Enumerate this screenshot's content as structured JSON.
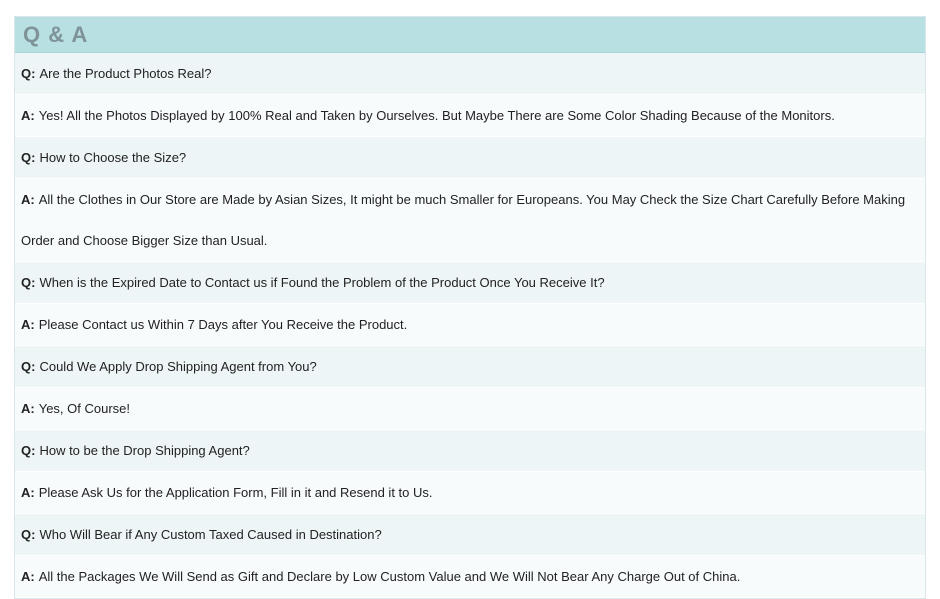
{
  "header": {
    "title": "Q & A"
  },
  "labels": {
    "question": "Q:",
    "answer": "A:"
  },
  "items": [
    {
      "type": "q",
      "text": "Are the Product Photos Real?"
    },
    {
      "type": "a",
      "text": "Yes! All the Photos Displayed by 100% Real and Taken by Ourselves. But Maybe There are Some Color Shading Because of the Monitors."
    },
    {
      "type": "q",
      "text": "How to Choose the Size?"
    },
    {
      "type": "a",
      "text": "All the Clothes in Our Store are Made by Asian Sizes, It might be much Smaller for Europeans. You May Check the Size Chart Carefully Before Making Order and Choose Bigger Size than Usual."
    },
    {
      "type": "q",
      "text": "When is the Expired Date to Contact us if Found the Problem of the Product Once You Receive It?"
    },
    {
      "type": "a",
      "text": "Please Contact us Within 7 Days after You Receive the Product."
    },
    {
      "type": "q",
      "text": "Could We Apply Drop Shipping Agent from You?"
    },
    {
      "type": "a",
      "text": "Yes, Of Course!"
    },
    {
      "type": "q",
      "text": "How to be the Drop Shipping Agent?"
    },
    {
      "type": "a",
      "text": "Please Ask Us for the Application Form, Fill in it and Resend it to Us."
    },
    {
      "type": "q",
      "text": "Who Will Bear if Any Custom Taxed Caused in Destination?"
    },
    {
      "type": "a",
      "text": "All the Packages We Will Send as Gift and Declare by Low Custom Value and We Will Not Bear Any Charge Out of China."
    }
  ]
}
